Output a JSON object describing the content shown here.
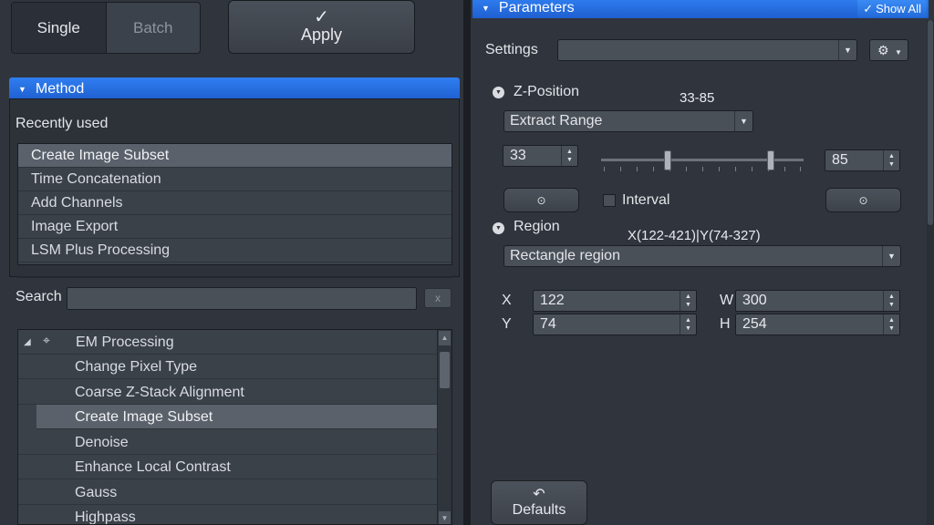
{
  "top": {
    "mode_single": "Single",
    "mode_batch": "Batch",
    "apply_icon": "✓",
    "apply_label": "Apply"
  },
  "method": {
    "header": "Method",
    "recently_used_label": "Recently used",
    "recent_items": [
      "Create Image Subset",
      "Time Concatenation",
      "Add Channels",
      "Image Export",
      "LSM Plus Processing"
    ],
    "selected_recent": "Create Image Subset",
    "search_label": "Search",
    "search_value": "",
    "search_clear": "x",
    "tree": {
      "group": "EM Processing",
      "group_expanded": true,
      "items": [
        "Change Pixel Type",
        "Coarse Z-Stack Alignment",
        "Create Image Subset",
        "Denoise",
        "Enhance Local Contrast",
        "Gauss",
        "Highpass"
      ],
      "selected": "Create Image Subset"
    }
  },
  "parameters": {
    "header": "Parameters",
    "show_all": "Show All",
    "show_all_checked": true,
    "settings_label": "Settings",
    "settings_value": "",
    "z_position": {
      "label": "Z-Position",
      "range_text": "33-85",
      "mode": "Extract Range",
      "start": "33",
      "end": "85",
      "interval_label": "Interval",
      "interval_checked": false
    },
    "region": {
      "label": "Region",
      "range_text": "X(122-421)|Y(74-327)",
      "mode": "Rectangle region",
      "x_label": "X",
      "x_value": "122",
      "y_label": "Y",
      "y_value": "74",
      "w_label": "W",
      "w_value": "300",
      "h_label": "H",
      "h_value": "254"
    },
    "defaults_label": "Defaults"
  },
  "colors": {
    "panel_bg": "#30353d",
    "header_blue": "#2a73e8",
    "selection": "#5a616b"
  }
}
